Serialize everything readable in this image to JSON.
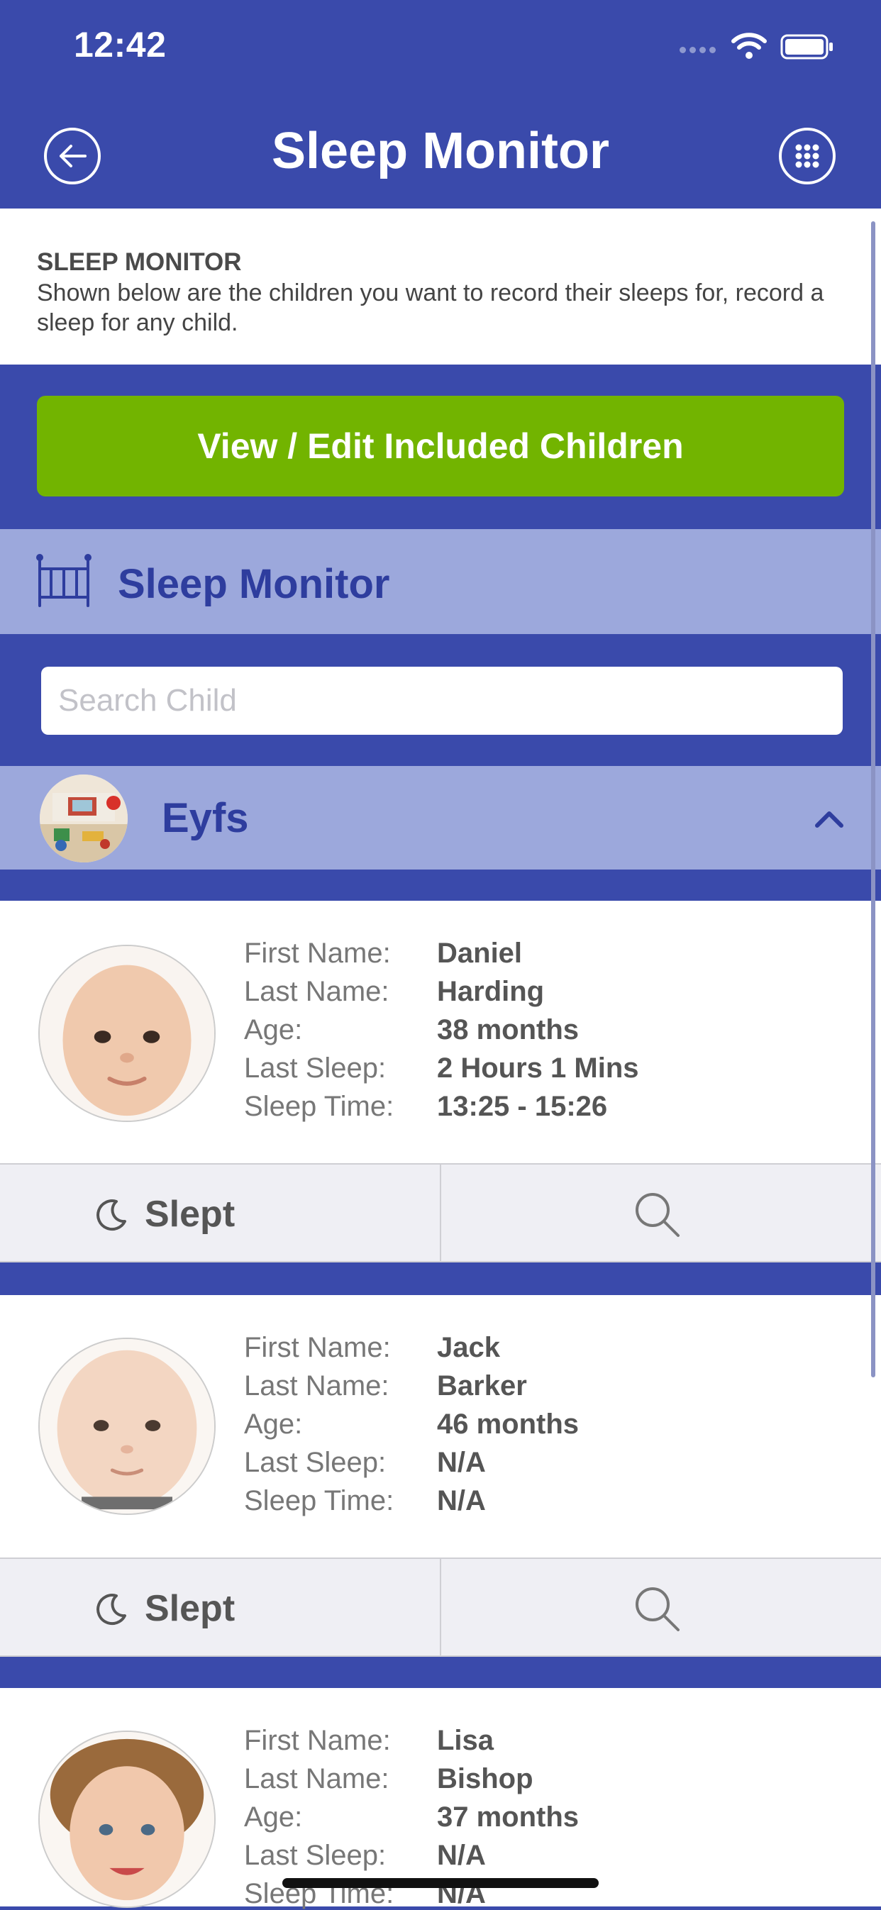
{
  "status_bar": {
    "time": "12:42"
  },
  "nav": {
    "title": "Sleep Monitor"
  },
  "info": {
    "title": "SLEEP MONITOR",
    "text": "Shown below are the children you want to record their sleeps for, record a sleep for any child."
  },
  "edit_button": {
    "label": "View / Edit Included Children"
  },
  "section": {
    "label": "Sleep Monitor"
  },
  "search": {
    "placeholder": "Search Child",
    "value": ""
  },
  "group": {
    "name": "Eyfs"
  },
  "field_labels": {
    "first_name": "First Name:",
    "last_name": "Last Name:",
    "age": "Age:",
    "last_sleep": "Last Sleep:",
    "sleep_time": "Sleep Time:"
  },
  "children": [
    {
      "first_name": "Daniel",
      "last_name": "Harding",
      "age": "38 months",
      "last_sleep": "2 Hours 1 Mins",
      "sleep_time": "13:25 - 15:26"
    },
    {
      "first_name": "Jack",
      "last_name": "Barker",
      "age": "46 months",
      "last_sleep": "N/A",
      "sleep_time": "N/A"
    },
    {
      "first_name": "Lisa",
      "last_name": "Bishop",
      "age": "37 months",
      "last_sleep": "N/A",
      "sleep_time": "N/A"
    }
  ],
  "actions": {
    "slept_label": "Slept"
  },
  "colors": {
    "primary": "#3a4aab",
    "accent_green": "#72b400",
    "section_bg": "#9ca8dc"
  }
}
